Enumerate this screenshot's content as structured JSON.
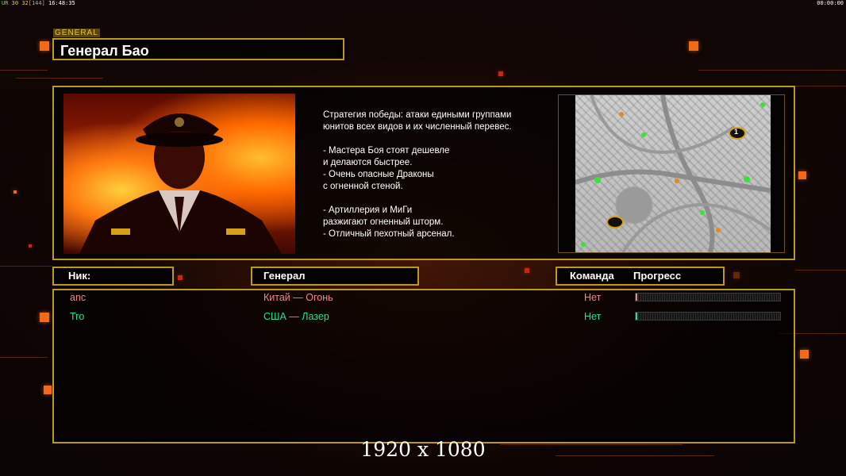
{
  "overlay": {
    "fps_label": "UR",
    "fps_value": "30",
    "fps_detail": "32",
    "fps_bracket": "[144]",
    "clock": "16:48:35",
    "timer": "00:00:00"
  },
  "general": {
    "tag": "GENERAL",
    "name": "Генерал Бао",
    "description": [
      "Стратегия победы: атаки едиными группами",
      "юнитов всех видов и их численный перевес.",
      "",
      "- Мастера Боя стоят дешевле",
      "и делаются быстрее.",
      "- Очень опасные Драконы",
      "с огненной стеной.",
      "",
      "- Артиллерия и МиГи",
      "разжигают огненный шторм.",
      "- Отличный пехотный арсенал."
    ]
  },
  "minimap": {
    "start_marker_1": "1"
  },
  "table": {
    "headers": {
      "nick": "Ник:",
      "general": "Генерал",
      "team": "Команда",
      "progress": "Прогресс"
    },
    "players": [
      {
        "nick": "anc",
        "general": "Китай — Огонь",
        "team": "Нет",
        "progress": 0.01,
        "color": "#e98a8a"
      },
      {
        "nick": "Tro",
        "general": "США — Лазер",
        "team": "Нет",
        "progress": 0.01,
        "color": "#2fe08a"
      }
    ]
  },
  "footer": {
    "resolution": "1920 x 1080"
  },
  "colors": {
    "frame": "#b89a22",
    "accent": "#f06a18"
  }
}
